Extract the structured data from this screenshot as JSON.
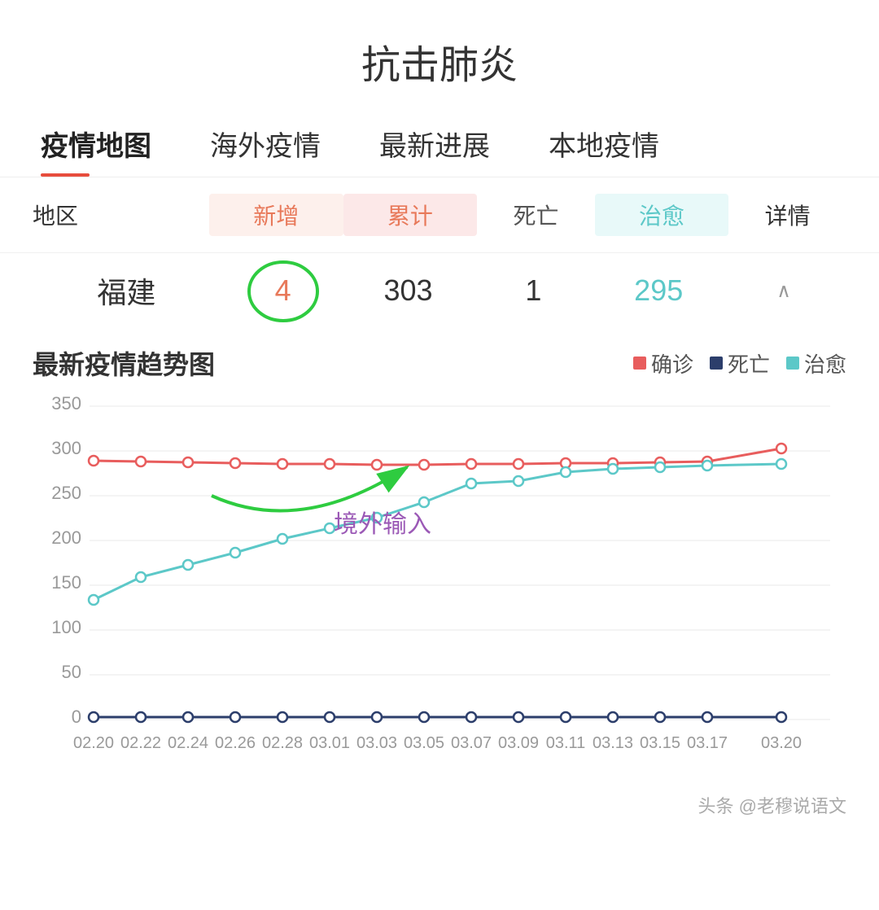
{
  "page": {
    "title": "抗击肺炎"
  },
  "nav": {
    "tabs": [
      {
        "label": "疫情地图",
        "active": true
      },
      {
        "label": "海外疫情",
        "active": false
      },
      {
        "label": "最新进展",
        "active": false
      },
      {
        "label": "本地疫情",
        "active": false
      }
    ]
  },
  "table": {
    "headers": {
      "region": "地区",
      "new": "新增",
      "total": "累计",
      "death": "死亡",
      "heal": "治愈",
      "detail": "详情"
    },
    "row": {
      "region": "福建",
      "new": "4",
      "total": "303",
      "death": "1",
      "heal": "295"
    }
  },
  "trend": {
    "title": "最新疫情趋势图",
    "legend": [
      {
        "label": "确诊",
        "color": "#e85d5d"
      },
      {
        "label": "死亡",
        "color": "#2c3e6b"
      },
      {
        "label": "治愈",
        "color": "#5cc8c8"
      }
    ],
    "annotation_text": "境外输入",
    "yAxis": [
      350,
      300,
      250,
      200,
      150,
      100,
      50,
      0
    ],
    "xAxis": [
      "02.20",
      "02.22",
      "02.24",
      "02.26",
      "02.28",
      "03.01",
      "03.03",
      "03.05",
      "03.07",
      "03.09",
      "03.11",
      "03.13",
      "03.15",
      "03.17",
      "03.20"
    ]
  },
  "watermark": "头条 @老穆说语文"
}
